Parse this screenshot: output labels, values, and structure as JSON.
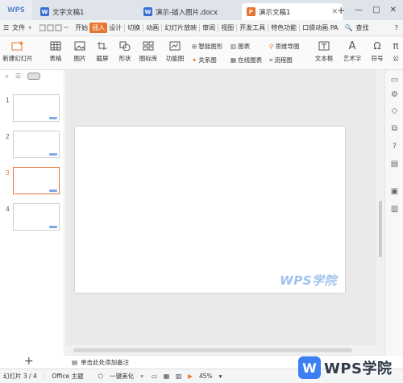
{
  "titlebar": {
    "app": "WPS",
    "tabs": [
      {
        "label": "文字文稿1",
        "icon": "W",
        "color": "#3b6fd1"
      },
      {
        "label": "演示-插入图片.docx",
        "icon": "W",
        "color": "#3b6fd1"
      },
      {
        "label": "演示文稿1",
        "icon": "P",
        "color": "#e8752f"
      }
    ],
    "new_tab": "+",
    "window": {
      "minimize": "—",
      "maximize": "□",
      "close": "✕"
    }
  },
  "menubar": {
    "file": "文件",
    "items": [
      "开始",
      "插入",
      "设计",
      "切换",
      "动画",
      "幻灯片放映",
      "审阅",
      "视图",
      "开发工具",
      "特色功能",
      "口袋动画 PA"
    ],
    "active": "插入",
    "search": "查找"
  },
  "ribbon": {
    "new_slide": "新建幻灯片",
    "table": "表格",
    "image": "图片",
    "screenshot": "截屏",
    "shape": "形状",
    "icon_lib": "图标库",
    "function_chart": "功能图",
    "smart_shape": "智能图形",
    "relation": "关系图",
    "chart": "图表",
    "online_chart": "在线图表",
    "mindmap": "思维导图",
    "flowchart": "流程图",
    "textbox": "文本框",
    "art_text": "艺术字",
    "symbol": "符号",
    "formula": "公"
  },
  "slides": {
    "numbers": [
      "1",
      "2",
      "3",
      "4"
    ],
    "selected": "3",
    "add": "+"
  },
  "canvas": {
    "watermark": "WPS学院"
  },
  "notes": {
    "placeholder": "单击此处添加备注"
  },
  "status": {
    "slide_counter": "幻灯片 3 / 4",
    "theme": "Office 主题",
    "beautify": "一键美化",
    "zoom": "45%"
  },
  "logo": {
    "badge": "W",
    "text": "WPS学院"
  },
  "colors": {
    "accent": "#e8752f",
    "brand_blue": "#3d7ff3",
    "watermark": "#9fc2ee"
  }
}
